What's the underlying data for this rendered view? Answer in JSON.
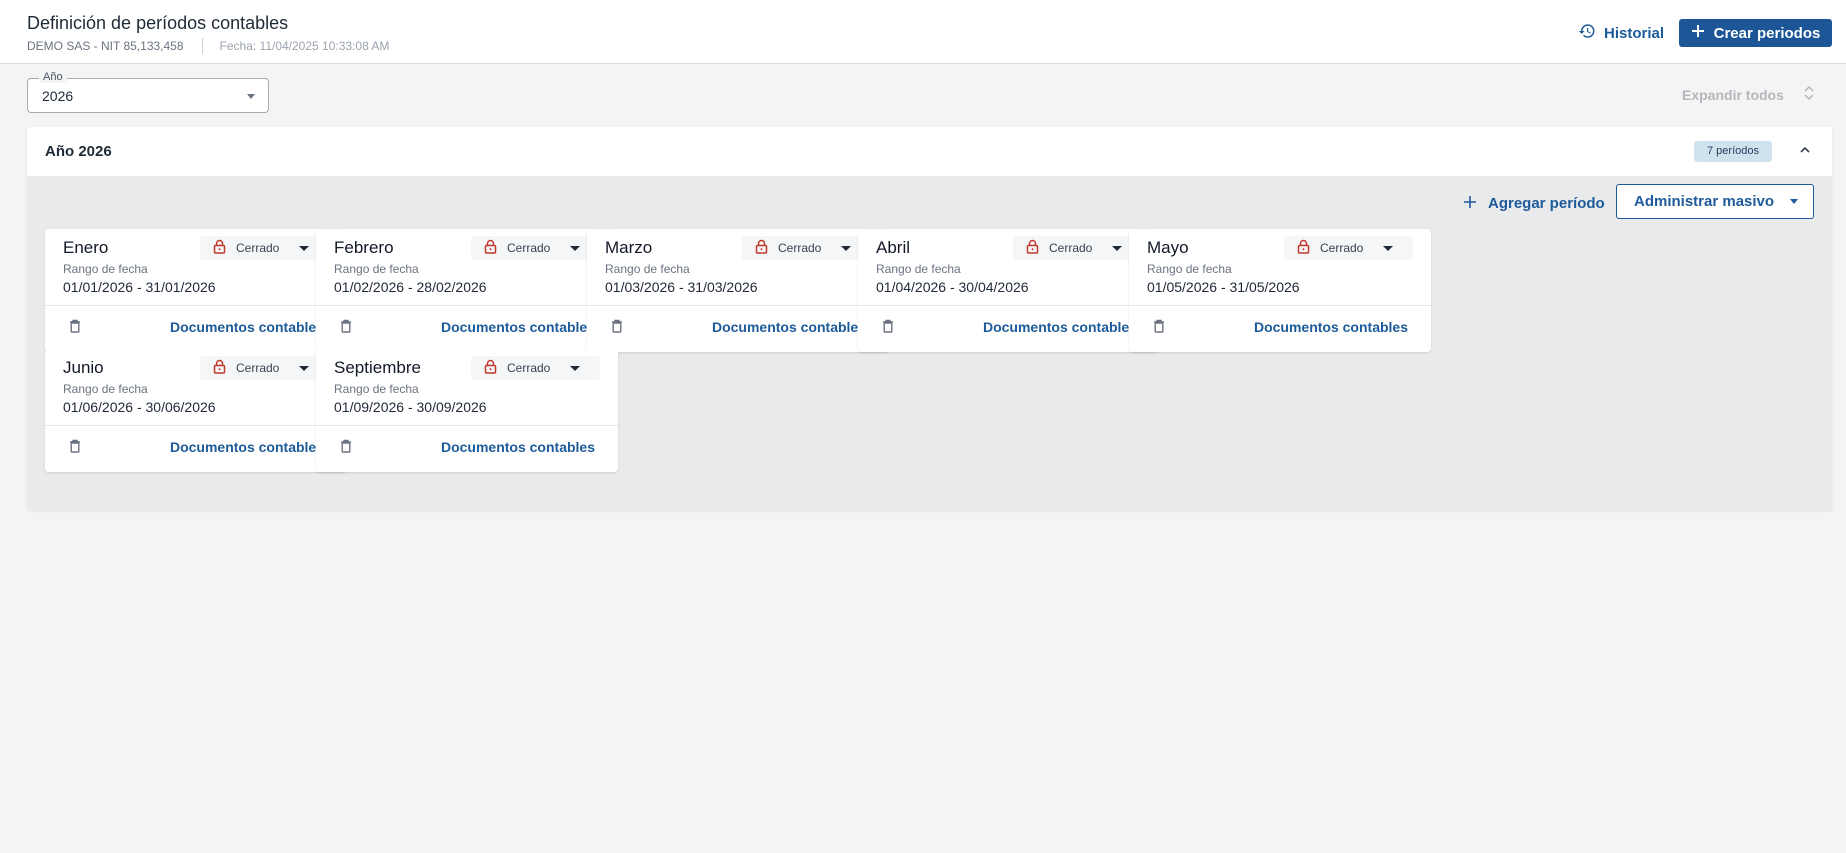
{
  "header": {
    "title": "Definición de períodos contables",
    "company": "DEMO SAS - NIT 85,133,458",
    "date": "Fecha: 11/04/2025 10:33:08 AM",
    "history_label": "Historial",
    "create_label": "Crear periodos"
  },
  "filter": {
    "year_label": "Año",
    "year_value": "2026",
    "expand_all_label": "Expandir todos"
  },
  "panel": {
    "title": "Año 2026",
    "badge": "7 períodos",
    "add_period_label": "Agregar período",
    "bulk_label": "Administrar masivo"
  },
  "card_common": {
    "range_label": "Rango de fecha",
    "docs_label": "Documentos contables"
  },
  "periods": [
    {
      "name": "Enero",
      "status": "Cerrado",
      "range": "01/01/2026 - 31/01/2026"
    },
    {
      "name": "Febrero",
      "status": "Cerrado",
      "range": "01/02/2026 - 28/02/2026"
    },
    {
      "name": "Marzo",
      "status": "Cerrado",
      "range": "01/03/2026 - 31/03/2026"
    },
    {
      "name": "Abril",
      "status": "Cerrado",
      "range": "01/04/2026 - 30/04/2026"
    },
    {
      "name": "Mayo",
      "status": "Cerrado",
      "range": "01/05/2026 - 31/05/2026"
    },
    {
      "name": "Junio",
      "status": "Cerrado",
      "range": "01/06/2026 - 30/06/2026"
    },
    {
      "name": "Septiembre",
      "status": "Cerrado",
      "range": "01/09/2026 - 30/09/2026"
    }
  ],
  "colors": {
    "primary": "#1c5696",
    "lock": "#c0392b",
    "badge_bg": "#cfe3ef"
  },
  "icons": {
    "history": "history-icon",
    "create": "plus-icon",
    "lock": "lock-icon",
    "trash": "trash-icon",
    "collapse": "chevron-up-icon",
    "expand": "unfold-icon"
  }
}
